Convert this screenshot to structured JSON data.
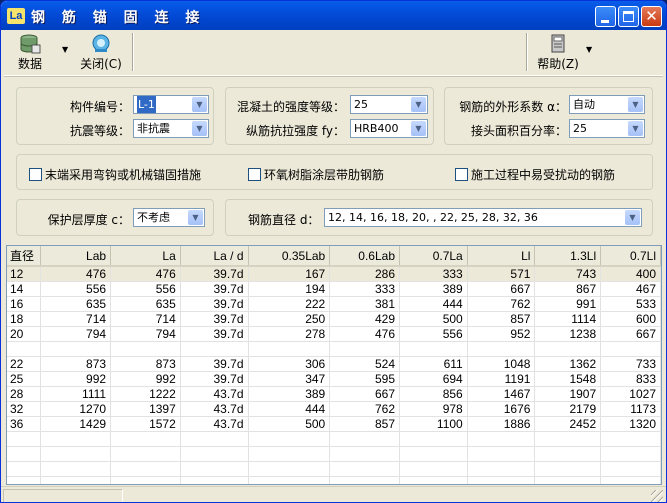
{
  "window": {
    "title": "钢 筋 锚 固 连 接",
    "app_icon_text": "La"
  },
  "toolbar": {
    "data_label": "数据",
    "close_label": "关闭(C)",
    "help_label": "帮助(Z)"
  },
  "form": {
    "component_no_label": "构件编号：",
    "component_no_value": "L-1",
    "seismic_grade_label": "抗震等级：",
    "seismic_grade_value": "非抗震",
    "concrete_grade_label": "混凝土的强度等级：",
    "concrete_grade_value": "25",
    "rebar_strength_label": "纵筋抗拉强度 fy：",
    "rebar_strength_value": "HRB400",
    "shape_coef_label": "钢筋的外形系数 α：",
    "shape_coef_value": "自动",
    "joint_ratio_label": "接头面积百分率：",
    "joint_ratio_value": "25",
    "check_hook_label": "末端采用弯钩或机械锚固措施",
    "check_epoxy_label": "环氧树脂涂层带肋钢筋",
    "check_disturb_label": "施工过程中易受扰动的钢筋",
    "cover_label": "保护层厚度 c：",
    "cover_value": "不考虑",
    "diameter_label": "钢筋直径 d：",
    "diameter_value": "12, 14, 16, 18, 20, , 22, 25, 28, 32, 36"
  },
  "table": {
    "headers": [
      "直径",
      "Lab",
      "La",
      "La / d",
      "0.35Lab",
      "0.6Lab",
      "0.7La",
      "Ll",
      "1.3Ll",
      "0.7Ll"
    ],
    "rows": [
      [
        "12",
        "476",
        "476",
        "39.7d",
        "167",
        "286",
        "333",
        "571",
        "743",
        "400"
      ],
      [
        "14",
        "556",
        "556",
        "39.7d",
        "194",
        "333",
        "389",
        "667",
        "867",
        "467"
      ],
      [
        "16",
        "635",
        "635",
        "39.7d",
        "222",
        "381",
        "444",
        "762",
        "991",
        "533"
      ],
      [
        "18",
        "714",
        "714",
        "39.7d",
        "250",
        "429",
        "500",
        "857",
        "1114",
        "600"
      ],
      [
        "20",
        "794",
        "794",
        "39.7d",
        "278",
        "476",
        "556",
        "952",
        "1238",
        "667"
      ],
      [
        "",
        "",
        "",
        "",
        "",
        "",
        "",
        "",
        "",
        ""
      ],
      [
        "22",
        "873",
        "873",
        "39.7d",
        "306",
        "524",
        "611",
        "1048",
        "1362",
        "733"
      ],
      [
        "25",
        "992",
        "992",
        "39.7d",
        "347",
        "595",
        "694",
        "1191",
        "1548",
        "833"
      ],
      [
        "28",
        "1111",
        "1222",
        "43.7d",
        "389",
        "667",
        "856",
        "1467",
        "1907",
        "1027"
      ],
      [
        "32",
        "1270",
        "1397",
        "43.7d",
        "444",
        "762",
        "978",
        "1676",
        "2179",
        "1173"
      ],
      [
        "36",
        "1429",
        "1572",
        "43.7d",
        "500",
        "857",
        "1100",
        "1886",
        "2452",
        "1320"
      ],
      [
        "",
        "",
        "",
        "",
        "",
        "",
        "",
        "",
        "",
        ""
      ],
      [
        "",
        "",
        "",
        "",
        "",
        "",
        "",
        "",
        "",
        ""
      ],
      [
        "",
        "",
        "",
        "",
        "",
        "",
        "",
        "",
        "",
        ""
      ],
      [
        "",
        "",
        "",
        "",
        "",
        "",
        "",
        "",
        "",
        ""
      ]
    ]
  }
}
